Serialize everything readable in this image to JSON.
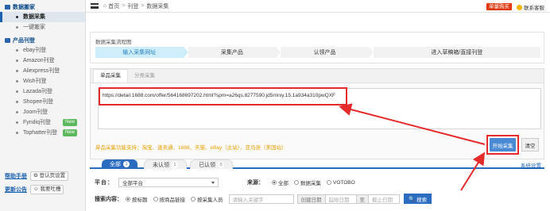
{
  "sidebar": {
    "sections": [
      {
        "title": "数据搬家",
        "items": [
          {
            "label": "数据采集",
            "active": true
          },
          {
            "label": "一键搬家",
            "active": false
          }
        ]
      },
      {
        "title": "产品刊登",
        "items": [
          {
            "label": "ebay刊登"
          },
          {
            "label": "Amazon刊登"
          },
          {
            "label": "Aliexpress刊登"
          },
          {
            "label": "Wish刊登"
          },
          {
            "label": "Lazada刊登"
          },
          {
            "label": "Shopee刊登"
          },
          {
            "label": "Joom刊登"
          },
          {
            "label": "Fyndiq刊登",
            "badge": "New"
          },
          {
            "label": "Tophatter刊登",
            "badge": "New"
          }
        ]
      }
    ],
    "help_link": "帮助手册",
    "login_settings": "登认页设置",
    "announce_link": "更新公告",
    "feedback": "我要吐槽"
  },
  "topbar": {
    "breadcrumb": [
      "首页",
      "刊登",
      "数据采集"
    ],
    "buy_button": "单量购买",
    "support": "联系客服"
  },
  "flow": {
    "title": "数据采集流程图",
    "steps": [
      "输入采集网址",
      "采集产品",
      "认领产品",
      "进入草稿箱/直接刊登"
    ]
  },
  "collect": {
    "tabs": [
      "单品采集",
      "分类采集"
    ],
    "url_value": "https://detail.1688.com/offer/564168697202.html?spm=a26qs.8277590.jd5rnniy.15.1a934a310pwQXF",
    "supported_sites": "单品采集功能支持：淘宝、速卖通、1688、天猫、eBay（主站）、亚马逊（美国站）",
    "start_button": "开始采集",
    "clear_button": "清空"
  },
  "filter": {
    "tabs": [
      {
        "label": "全部",
        "count": "1"
      },
      {
        "label": "未认领",
        "count": "1"
      },
      {
        "label": "已认领",
        "count": "0"
      }
    ],
    "system_settings": "系统设置",
    "platform_label": "平台：",
    "platform_value": "全部平台",
    "source_label": "来源：",
    "source_options": [
      "全部",
      "数据采集",
      "VOTOBO"
    ],
    "search_label": "搜索内容：",
    "search_options": [
      "按标题",
      "按商品链接",
      "按采集人员"
    ],
    "keyword_placeholder": "请输入关键字",
    "created_date": "创建日期",
    "start_date": "起始日期",
    "to": "至",
    "end_date": "截止日期",
    "search_button": "搜索"
  },
  "colors": {
    "accent": "#2b6cc0",
    "highlight": "#e52b2b",
    "step_active": "#cdeefa",
    "supported": "#e8a000"
  }
}
